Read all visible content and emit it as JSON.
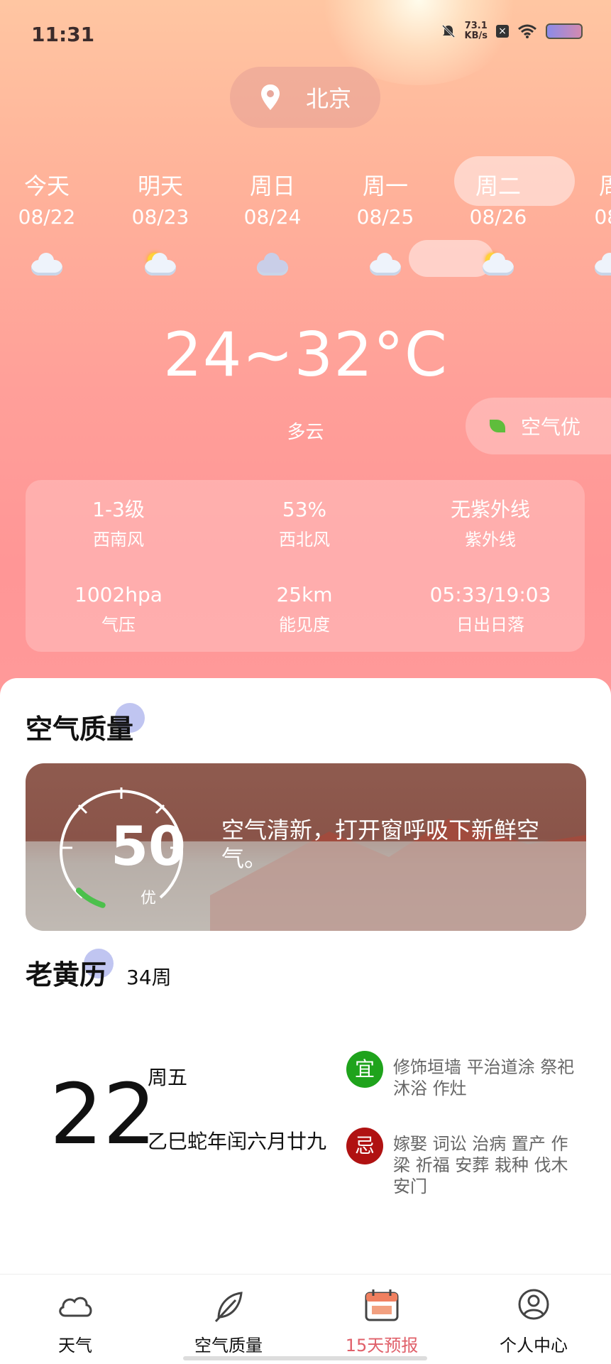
{
  "status_bar": {
    "time": "11:31",
    "net_speed_value": "73.1",
    "net_speed_unit": "KB/s"
  },
  "location": {
    "city": "北京"
  },
  "forecast": [
    {
      "day": "今天",
      "date": "08/22",
      "icon": "cloudy-icon"
    },
    {
      "day": "明天",
      "date": "08/23",
      "icon": "partly-cloudy-icon"
    },
    {
      "day": "周日",
      "date": "08/24",
      "icon": "overcast-icon"
    },
    {
      "day": "周一",
      "date": "08/25",
      "icon": "cloudy-icon"
    },
    {
      "day": "周二",
      "date": "08/26",
      "icon": "partly-cloudy-icon"
    },
    {
      "day": "周",
      "date": "08/",
      "icon": "cloudy-icon"
    }
  ],
  "current": {
    "temp_range": "24~32°C",
    "condition": "多云",
    "air_badge": "空气优"
  },
  "details": [
    {
      "value": "1-3级",
      "label": "西南风"
    },
    {
      "value": "53%",
      "label": "西北风"
    },
    {
      "value": "无紫外线",
      "label": "紫外线"
    },
    {
      "value": "1002hpa",
      "label": "气压"
    },
    {
      "value": "25km",
      "label": "能见度"
    },
    {
      "value": "05:33/19:03",
      "label": "日出日落"
    }
  ],
  "air_quality": {
    "title": "空气质量",
    "aqi": "50",
    "grade": "优",
    "message": "空气清新，打开窗呼吸下新鲜空气。",
    "gauge_fraction": 0.1
  },
  "almanac": {
    "title": "老黄历",
    "week": "34周",
    "day": "22",
    "weekday": "周五",
    "lunar": "乙巳蛇年闰六月廿九",
    "yi_label": "宜",
    "yi": "修饰垣墙 平治道涂 祭祀 沐浴 作灶",
    "ji_label": "忌",
    "ji": "嫁娶 词讼 治病 置产 作梁 祈福 安葬 栽种 伐木 安门"
  },
  "tabs": [
    {
      "label": "天气",
      "icon": "cloud-icon"
    },
    {
      "label": "空气质量",
      "icon": "leaf-icon"
    },
    {
      "label": "15天预报",
      "icon": "calendar-icon",
      "active": true
    },
    {
      "label": "个人中心",
      "icon": "person-icon"
    }
  ],
  "colors": {
    "accent": "#e0606a",
    "yi": "#1fa31c",
    "ji": "#b01212"
  }
}
